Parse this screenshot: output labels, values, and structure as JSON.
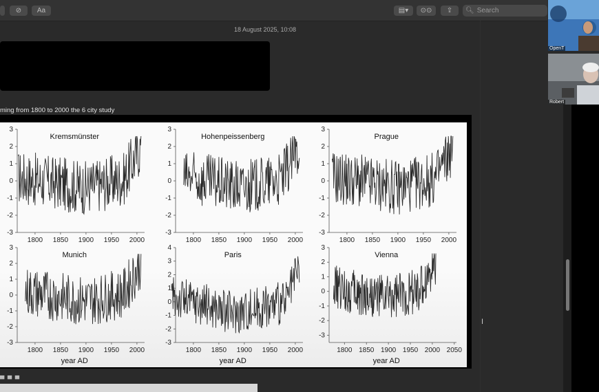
{
  "toolbar": {
    "buttons": [
      {
        "label": "",
        "icon": "markup-icon"
      },
      {
        "label": "",
        "icon": "circle-check-icon"
      },
      {
        "label": "Aa",
        "icon": "text-format-icon"
      }
    ],
    "right_buttons": [
      {
        "icon": "media-icon"
      },
      {
        "icon": "collaborate-icon"
      },
      {
        "icon": "share-icon"
      }
    ],
    "search_placeholder": "Search"
  },
  "note": {
    "timestamp": "18 August 2025, 10:08",
    "caption": "ming from 1800 to 2000 the 6 city study"
  },
  "participants": [
    {
      "name": "OpenT"
    },
    {
      "name": "Robert"
    }
  ],
  "chart_data": [
    {
      "type": "line",
      "title": "Kremsmünster",
      "xlabel": "",
      "ylim": [
        -3,
        3
      ],
      "yticks": [
        -3,
        -2,
        -1,
        0,
        1,
        2,
        3
      ],
      "xticks": [
        1800,
        1850,
        1900,
        1950,
        2000
      ],
      "xlim": [
        1765,
        2015
      ],
      "data_range": [
        1767,
        2008
      ],
      "trend": "rise-late"
    },
    {
      "type": "line",
      "title": "Hohenpeissenberg",
      "xlabel": "",
      "ylim": [
        -3,
        3
      ],
      "yticks": [
        -3,
        -2,
        -1,
        0,
        1,
        2,
        3
      ],
      "xticks": [
        1800,
        1850,
        1900,
        1950,
        2000
      ],
      "xlim": [
        1765,
        2015
      ],
      "data_range": [
        1781,
        2008
      ],
      "trend": "rise-late"
    },
    {
      "type": "line",
      "title": "Prague",
      "xlabel": "",
      "ylim": [
        -3,
        3
      ],
      "yticks": [
        -3,
        -2,
        -1,
        0,
        1,
        2,
        3
      ],
      "xticks": [
        1800,
        1850,
        1900,
        1950,
        2000
      ],
      "xlim": [
        1765,
        2015
      ],
      "data_range": [
        1771,
        2008
      ],
      "trend": "rise-late"
    },
    {
      "type": "line",
      "title": "Munich",
      "xlabel": "year AD",
      "ylim": [
        -3,
        3
      ],
      "yticks": [
        -3,
        -2,
        -1,
        0,
        1,
        2,
        3
      ],
      "xticks": [
        1800,
        1850,
        1900,
        1950,
        2000
      ],
      "xlim": [
        1765,
        2015
      ],
      "data_range": [
        1781,
        2008
      ],
      "trend": "rise-late"
    },
    {
      "type": "line",
      "title": "Paris",
      "xlabel": "year AD",
      "ylim": [
        -3,
        4
      ],
      "yticks": [
        -3,
        -2,
        -1,
        0,
        1,
        2,
        3,
        4
      ],
      "xticks": [
        1800,
        1850,
        1900,
        1950,
        2000
      ],
      "xlim": [
        1765,
        2015
      ],
      "data_range": [
        1757,
        2008
      ],
      "trend": "dip-then-rise"
    },
    {
      "type": "line",
      "title": "Vienna",
      "xlabel": "year AD",
      "ylim": [
        -3.5,
        3
      ],
      "yticks": [
        -3,
        -2,
        -1,
        0,
        1,
        2,
        3
      ],
      "xticks": [
        1800,
        1850,
        1900,
        1950,
        2000,
        2050
      ],
      "xlim": [
        1765,
        2055
      ],
      "data_range": [
        1775,
        2008
      ],
      "trend": "rise-late"
    }
  ],
  "colors": {
    "line": "#2b2b2b",
    "axis": "#555555",
    "background": "#2a2a2a"
  }
}
